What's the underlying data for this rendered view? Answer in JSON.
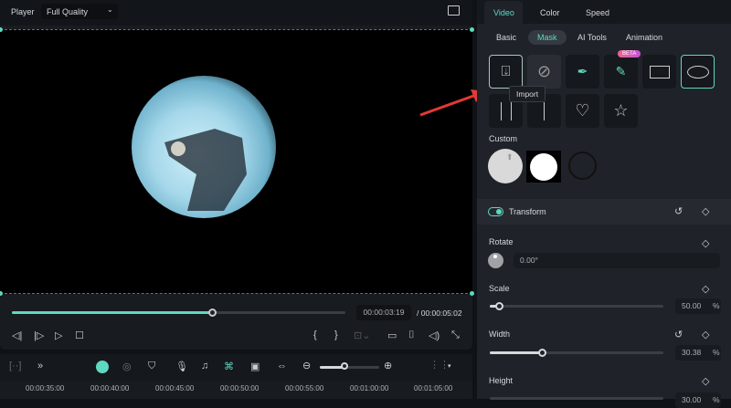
{
  "player": {
    "label": "Player",
    "quality": "Full Quality",
    "current_time": "00:00:03:19",
    "total_time": "/ 00:00:05:02",
    "progress": 0.6
  },
  "right": {
    "tabs": [
      "Video",
      "Color",
      "Speed"
    ],
    "subtabs": [
      "Basic",
      "Mask",
      "AI Tools",
      "Animation"
    ],
    "beta": "BETA",
    "tooltip": "Import",
    "custom_label": "Custom",
    "transform": {
      "label": "Transform",
      "enabled": true
    },
    "rotate": {
      "label": "Rotate",
      "value": "0.00°"
    },
    "scale": {
      "label": "Scale",
      "value": "50.00",
      "unit": "%",
      "fraction": 0.05
    },
    "width": {
      "label": "Width",
      "value": "30.38",
      "unit": "%",
      "fraction": 0.3
    },
    "height": {
      "label": "Height",
      "value": "30.00",
      "unit": "%"
    }
  },
  "timeline": {
    "ticks": [
      "00:00:35:00",
      "00:00:40:00",
      "00:00:45:00",
      "00:00:50:00",
      "00:00:55:00",
      "00:01:00:00",
      "00:01:05:00"
    ],
    "zoom": 0.5
  },
  "accent": "#5fd8c0"
}
